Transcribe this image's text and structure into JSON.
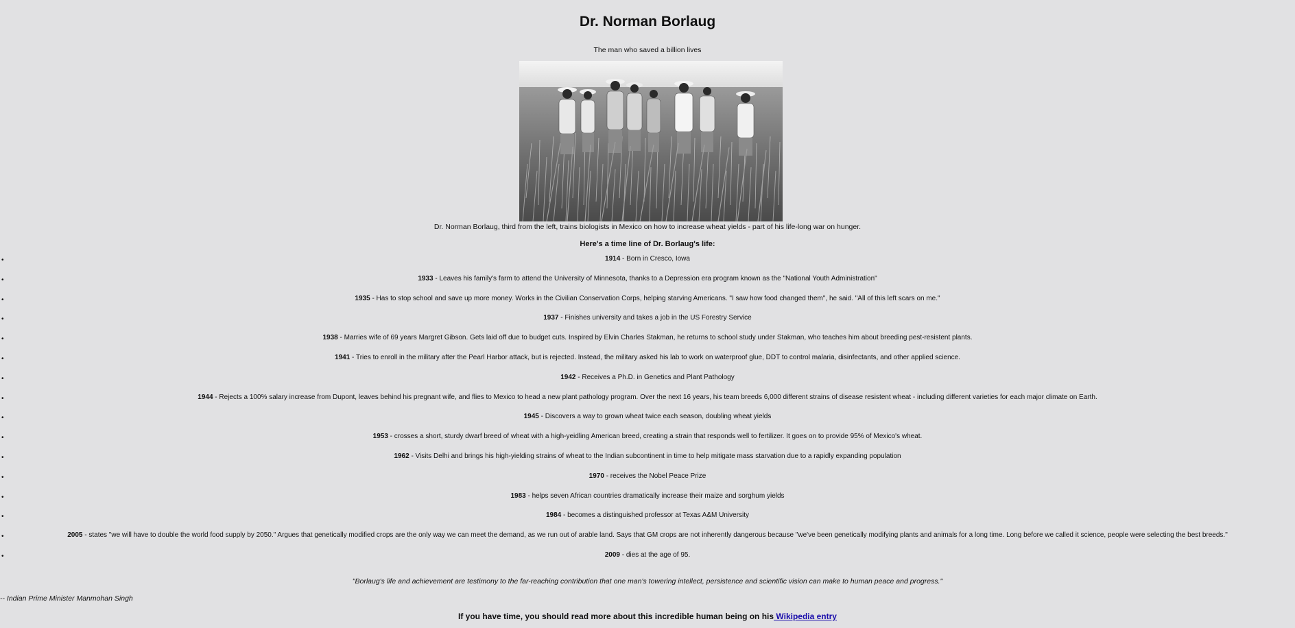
{
  "page": {
    "title": "Dr. Norman Borlaug",
    "subtitle": "The man who saved a billion lives"
  },
  "photo": {
    "icon": "field-photo",
    "caption": "Dr. Norman Borlaug, third from the left, trains biologists in Mexico on how to increase wheat yields - part of his life-long war on hunger."
  },
  "timeline": {
    "heading": "Here's a time line of Dr. Borlaug's life:",
    "items": [
      {
        "year": "1914",
        "text": " - Born in Cresco, Iowa"
      },
      {
        "year": "1933",
        "text": " - Leaves his family's farm to attend the University of Minnesota, thanks to a Depression era program known as the \"National Youth Administration\""
      },
      {
        "year": "1935",
        "text": " - Has to stop school and save up more money. Works in the Civilian Conservation Corps, helping starving Americans. \"I saw how food changed them\", he said. \"All of this left scars on me.\""
      },
      {
        "year": "1937",
        "text": " - Finishes university and takes a job in the US Forestry Service"
      },
      {
        "year": "1938",
        "text": " - Marries wife of 69 years Margret Gibson. Gets laid off due to budget cuts. Inspired by Elvin Charles Stakman, he returns to school study under Stakman, who teaches him about breeding pest-resistent plants."
      },
      {
        "year": "1941",
        "text": " - Tries to enroll in the military after the Pearl Harbor attack, but is rejected. Instead, the military asked his lab to work on waterproof glue, DDT to control malaria, disinfectants, and other applied science."
      },
      {
        "year": "1942",
        "text": " - Receives a Ph.D. in Genetics and Plant Pathology"
      },
      {
        "year": "1944",
        "text": " - Rejects a 100% salary increase from Dupont, leaves behind his pregnant wife, and flies to Mexico to head a new plant pathology program. Over the next 16 years, his team breeds 6,000 different strains of disease resistent wheat - including different varieties for each major climate on Earth."
      },
      {
        "year": "1945",
        "text": " - Discovers a way to grown wheat twice each season, doubling wheat yields"
      },
      {
        "year": "1953",
        "text": " - crosses a short, sturdy dwarf breed of wheat with a high-yeidling American breed, creating a strain that responds well to fertilizer. It goes on to provide 95% of Mexico's wheat."
      },
      {
        "year": "1962",
        "text": " - Visits Delhi and brings his high-yielding strains of wheat to the Indian subcontinent in time to help mitigate mass starvation due to a rapidly expanding population"
      },
      {
        "year": "1970",
        "text": " - receives the Nobel Peace Prize"
      },
      {
        "year": "1983",
        "text": " - helps seven African countries dramatically increase their maize and sorghum yields"
      },
      {
        "year": "1984",
        "text": " - becomes a distinguished professor at Texas A&M University"
      },
      {
        "year": "2005",
        "text": " - states \"we will have to double the world food supply by 2050.\" Argues that genetically modified crops are the only way we can meet the demand, as we run out of arable land. Says that GM crops are not inherently dangerous because \"we've been genetically modifying plants and animals for a long time. Long before we called it science, people were selecting the best breeds.\""
      },
      {
        "year": "2009",
        "text": " - dies at the age of 95."
      }
    ]
  },
  "quote": {
    "text": "\"Borlaug's life and achievement are testimony to the far-reaching contribution that one man's towering intellect, persistence and scientific vision can make to human peace and progress.\"",
    "attribution": "-- Indian Prime Minister Manmohan Singh"
  },
  "footer": {
    "text": "If you have time, you should read more about this incredible human being on his",
    "link_label": " Wikipedia entry"
  }
}
